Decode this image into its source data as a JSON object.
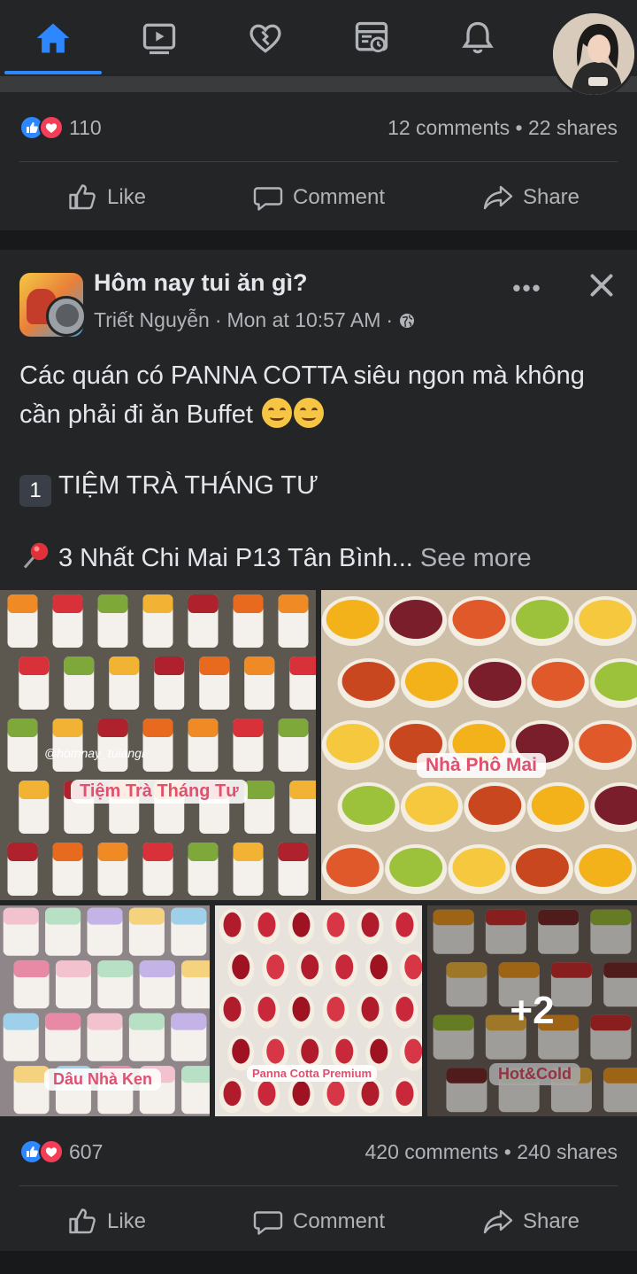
{
  "nav": {
    "tabs": [
      {
        "name": "home-icon",
        "active": true
      },
      {
        "name": "watch-icon",
        "active": false
      },
      {
        "name": "dating-icon",
        "active": false
      },
      {
        "name": "marketplace-icon",
        "active": false
      },
      {
        "name": "notifications-icon",
        "active": false
      }
    ],
    "accent_color": "#2d88ff"
  },
  "post1": {
    "reaction_count": "110",
    "comments": "12 comments",
    "shares": "22 shares",
    "separator": "•",
    "actions": {
      "like": "Like",
      "comment": "Comment",
      "share": "Share"
    }
  },
  "post2": {
    "group_name": "Hôm nay tui ăn gì?",
    "author": "Triết Nguyễn",
    "time": "Mon at 10:57 AM",
    "dot": "·",
    "more": "•••",
    "text_line1": "Các quán có PANNA COTTA siêu ngon mà không cần phải đi ăn Buffet",
    "keycap": "1",
    "text_line2": "TIỆM TRÀ THÁNG TƯ",
    "text_line3": "3 Nhất Chi Mai P13 Tân Bình...",
    "see_more": "See more",
    "photos": [
      {
        "label": "Tiệm Trà Tháng Tư",
        "watermark": "@homnay_tuiangi"
      },
      {
        "label": "Nhà Phô Mai"
      },
      {
        "label": "Dâu Nhà Ken"
      },
      {
        "label": "Panna Cotta Premium"
      },
      {
        "label": "Hot&Cold",
        "more_count": "+2"
      }
    ],
    "reaction_count": "607",
    "comments": "420 comments",
    "shares": "240 shares",
    "separator": "•",
    "actions": {
      "like": "Like",
      "comment": "Comment",
      "share": "Share"
    }
  },
  "colors": {
    "background": "#18191a",
    "card": "#242526",
    "text": "#e4e6eb",
    "secondary": "#b0b3b8",
    "like": "#2d88ff",
    "love": "#f33e58"
  }
}
